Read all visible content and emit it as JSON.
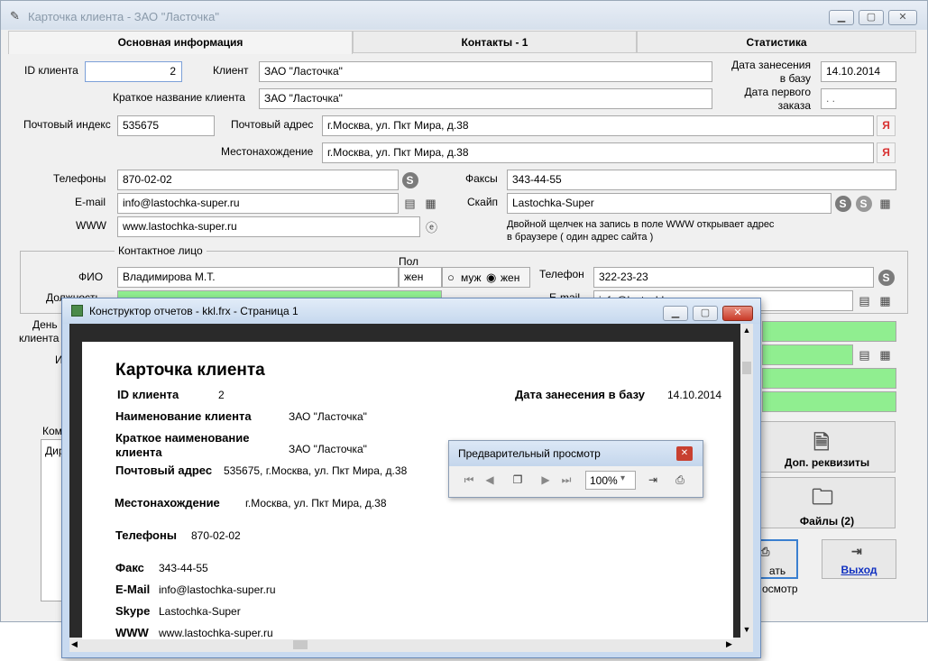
{
  "main_window": {
    "title": "Карточка клиента  -  ЗАО \"Ласточка\"",
    "tabs": [
      "Основная информация",
      "Контакты - 1",
      "Статистика"
    ]
  },
  "form": {
    "id_label": "ID клиента",
    "id_value": "2",
    "client_label": "Клиент",
    "client_value": "ЗАО \"Ласточка\"",
    "date_added_label_1": "Дата занесения",
    "date_added_label_2": "в базу",
    "date_added_value": "14.10.2014",
    "short_name_label": "Краткое название клиента",
    "short_name_value": "ЗАО \"Ласточка\"",
    "first_order_label_1": "Дата первого",
    "first_order_label_2": "заказа",
    "first_order_value": ". .",
    "postal_index_label": "Почтовый индекс",
    "postal_index_value": "535675",
    "postal_address_label": "Почтовый адрес",
    "postal_address_value": "г.Москва, ул. Пкт Мира, д.38",
    "location_label": "Местонахождение",
    "location_value": "г.Москва, ул. Пкт Мира, д.38",
    "phones_label": "Телефоны",
    "phones_value": "870-02-02",
    "fax_label": "Факсы",
    "fax_value": "343-44-55",
    "email_label": "E-mail",
    "email_value": "info@lastochka-super.ru",
    "skype_label": "Скайп",
    "skype_value": "Lastochka-Super",
    "www_label": "WWW",
    "www_value": "www.lastochka-super.ru",
    "www_hint_1": "Двойной щелчек на запись в поле WWW открывает адрес",
    "www_hint_2": "в браузере ( один адрес сайта )",
    "ya_label": "Я"
  },
  "contact": {
    "group_label": "Контактное лицо",
    "fio_label": "ФИО",
    "fio_value": "Владимирова М.Т.",
    "sex_label": "Пол",
    "sex_value": "жен",
    "male_label": "муж",
    "female_label": "жен",
    "phone_label": "Телефон",
    "phone_value": "322-23-23",
    "position_label": "Должность",
    "email_label": "E-mail",
    "email_value": "info@lastochka",
    "birthday_label_1": "День",
    "birthday_label_2": "клиента",
    "partial_label": "И",
    "comment_label": "Ком",
    "comment_value": "Дир"
  },
  "buttons": {
    "extra_details": "Доп. реквизиты",
    "files": "Файлы (2)",
    "print": "ать",
    "preview": "осмотр",
    "exit": "Выход"
  },
  "report_window": {
    "title": "Конструктор отчетов - kkl.frx - Страница 1",
    "heading": "Карточка клиента",
    "rows": [
      {
        "label": "ID клиента",
        "value": "2"
      },
      {
        "label": "Наименование клиента",
        "value": "ЗАО \"Ласточка\""
      },
      {
        "label": "Краткое наименование",
        "label2": "клиента",
        "value": "ЗАО \"Ласточка\""
      },
      {
        "label": "Почтовый адрес",
        "value": "535675, г.Москва, ул. Пкт Мира, д.38"
      },
      {
        "label": "Местонахождение",
        "value": "г.Москва, ул. Пкт Мира, д.38"
      },
      {
        "label": "Телефоны",
        "value": "870-02-02"
      },
      {
        "label": "Факс",
        "value": "343-44-55"
      },
      {
        "label": "E-Mail",
        "value": "info@lastochka-super.ru"
      },
      {
        "label": "Skype",
        "value": "Lastochka-Super"
      },
      {
        "label": "WWW",
        "value": "www.lastochka-super.ru"
      }
    ],
    "date_label": "Дата занесения в базу",
    "date_value": "14.10.2014"
  },
  "preview_toolbar": {
    "title": "Предварительный просмотр",
    "zoom": "100%"
  }
}
